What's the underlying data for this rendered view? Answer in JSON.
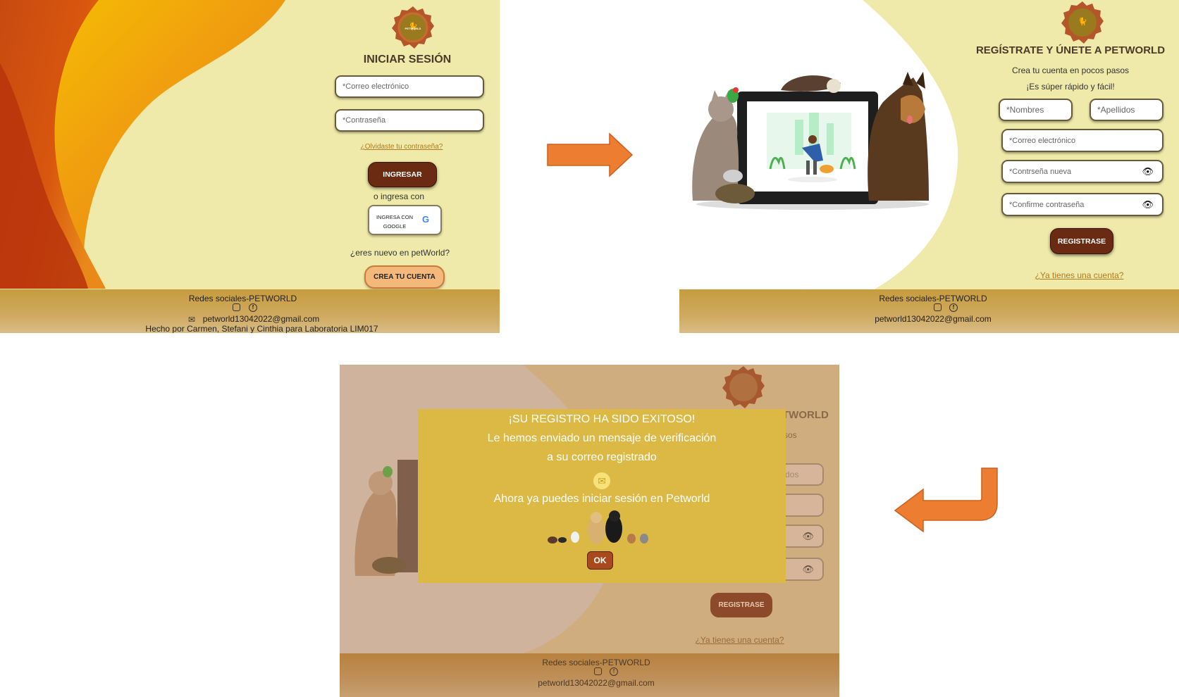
{
  "login": {
    "brand": "PETWORLD",
    "title": "INICIAR SESIÓN",
    "email_placeholder": "*Correo electrónico",
    "password_placeholder": "*Contraseña",
    "forgot_link": "¿Olvidaste tu contraseña?",
    "submit_label": "INGRESAR",
    "or_text": "o ingresa con",
    "google_label_line1": "INGRESA CON",
    "google_label_line2": "GOOGLE",
    "google_icon_text": "G",
    "new_user_text": "¿eres nuevo en petWorld?",
    "create_account_label": "CREA TU CUENTA",
    "footer_social": "Redes sociales-PETWORLD",
    "footer_email": "petworld13042022@gmail.com",
    "footer_credits": "Hecho por Carmen, Stefani y Cinthia para Laboratoria LIM017"
  },
  "register": {
    "brand": "PETWORLD",
    "title": "REGÍSTRATE Y ÚNETE A PETWORLD",
    "subtitle1": "Crea tu cuenta en pocos pasos",
    "subtitle2": "¡Es súper rápido y fácil!",
    "names_placeholder": "*Nombres",
    "lastnames_placeholder": "*Apellidos",
    "email_placeholder": "*Correo electrónico",
    "password_placeholder": "*Contrseña nueva",
    "confirm_placeholder": "*Confirme contraseña",
    "submit_label": "REGISTRASE",
    "have_account_link": "¿Ya tienes una cuenta?",
    "footer_social": "Redes sociales-PETWORLD",
    "footer_email": "petworld13042022@gmail.com"
  },
  "modal_screen": {
    "bg_title_fragment": "TWORLD",
    "bg_subtitle_fragment": "sos",
    "bg_field_fragment": "dos",
    "bg_submit_label": "REGISTRASE",
    "bg_have_account_link": "¿Ya tienes una cuenta?",
    "footer_social": "Redes sociales-PETWORLD",
    "footer_email": "petworld13042022@gmail.com",
    "modal": {
      "line1": "¡SU  REGISTRO HA SIDO EXITOSO!",
      "line2": "Le hemos enviado un mensaje de verificación",
      "line3": "a su correo registrado",
      "line4": "Ahora ya puedes iniciar sesión en  Petworld",
      "ok_label": "OK"
    }
  },
  "colors": {
    "arrow": "#ed7d31",
    "cream": "#efeaa9",
    "modal_bg": "#dcb944",
    "button_dark": "#6b2a12"
  },
  "icons": [
    "mail-icon",
    "instagram-icon",
    "facebook-icon",
    "google-icon",
    "eye-slash-icon",
    "arrow-right-icon",
    "arrow-return-icon",
    "petworld-logo-icon"
  ]
}
